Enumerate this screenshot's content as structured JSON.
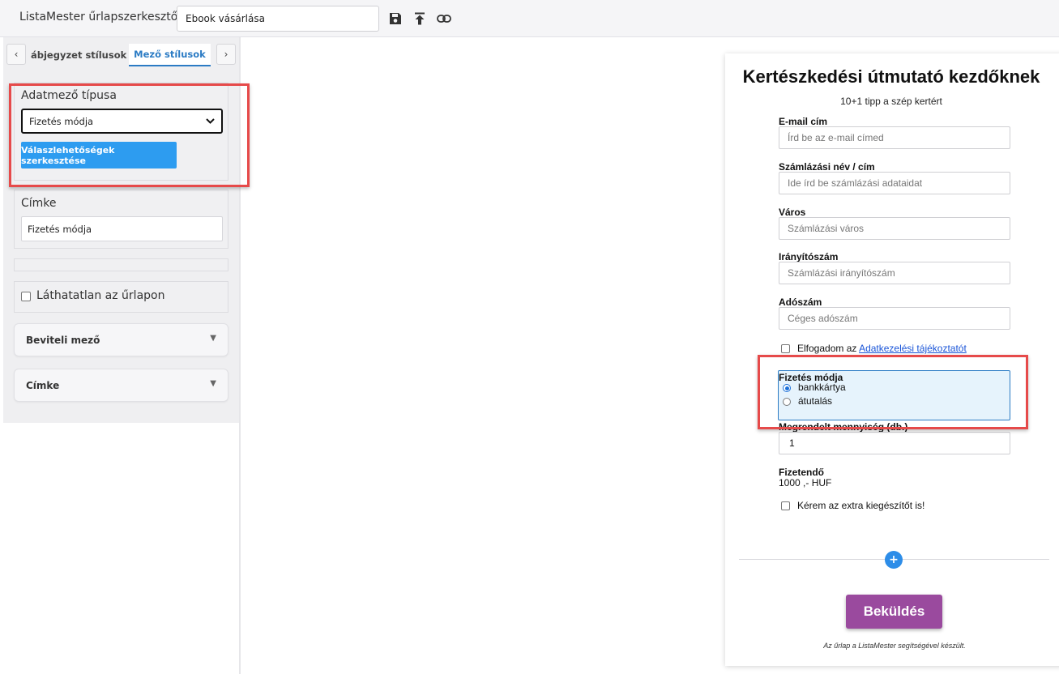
{
  "header": {
    "app_title": "ListaMester űrlapszerkesztő:",
    "form_name": "Ebook vásárlása",
    "icons": [
      "save-icon",
      "upload-icon",
      "link-icon"
    ]
  },
  "sidebar": {
    "tab_prev": "‹",
    "tab_next": "›",
    "tabs": [
      "ábjegyzet stílusok",
      "Mező stílusok"
    ],
    "field_type_label": "Adatmező típusa",
    "field_type_value": "Fizetés módja",
    "edit_options_button": "Válaszlehetőségek szerkesztése",
    "label_section_title": "Címke",
    "label_value": "Fizetés módja",
    "hidden_checkbox_label": "Láthatatlan az űrlapon",
    "accordions": [
      "Beviteli mező",
      "Címke"
    ]
  },
  "form": {
    "title": "Kertészkedési útmutató kezdőknek",
    "subtitle": "10+1 tipp a szép kertért",
    "fields": [
      {
        "label": "E-mail cím",
        "placeholder": "Írd be az e-mail címed"
      },
      {
        "label": "Számlázási név / cím",
        "placeholder": "Ide írd be számlázási adataidat"
      },
      {
        "label": "Város",
        "placeholder": "Számlázási város"
      },
      {
        "label": "Irányítószám",
        "placeholder": "Számlázási irányítószám"
      },
      {
        "label": "Adószám",
        "placeholder": "Céges adószám"
      }
    ],
    "consent_text": "Elfogadom az ",
    "consent_link": "Adatkezelési tájékoztatót",
    "payment_label": "Fizetés módja",
    "payment_options": [
      "bankkártya",
      "átutalás"
    ],
    "payment_selected": "bankkártya",
    "quantity_label": "Megrendelt mennyiség (db.)",
    "quantity_value": "1",
    "total_label": "Fizetendő",
    "total_value": "1000 ,- HUF",
    "extra_checkbox_label": "Kérem az extra kiegészítőt is!",
    "add_symbol": "+",
    "submit_label": "Beküldés",
    "footer_note": "Az űrlap a ListaMester segítségével készült."
  },
  "colors": {
    "accent_blue": "#2d9cf0",
    "submit_purple": "#9a4a9e",
    "highlight_red": "#e64a4a",
    "radio_group_bg": "#e6f3fc"
  }
}
